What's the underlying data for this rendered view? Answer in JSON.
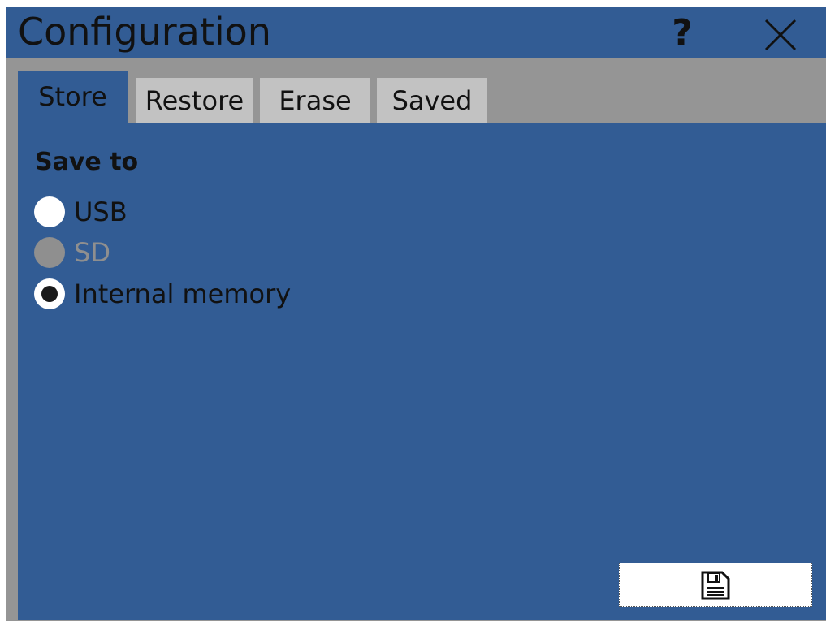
{
  "window": {
    "title": "Configuration",
    "help_label": "?",
    "close_icon": "close-icon"
  },
  "tabs": [
    {
      "label": "Store",
      "active": true
    },
    {
      "label": "Restore",
      "active": false
    },
    {
      "label": "Erase",
      "active": false
    },
    {
      "label": "Saved",
      "active": false
    }
  ],
  "store": {
    "section_title": "Save to",
    "options": [
      {
        "label": "USB",
        "selected": false,
        "enabled": true
      },
      {
        "label": "SD",
        "selected": false,
        "enabled": false
      },
      {
        "label": "Internal memory",
        "selected": true,
        "enabled": true
      }
    ],
    "save_button_icon": "save-icon"
  },
  "colors": {
    "accent": "#325c94",
    "frame": "#959595",
    "inactive_tab": "#c2c2c2",
    "disabled": "#8f8f8f"
  }
}
